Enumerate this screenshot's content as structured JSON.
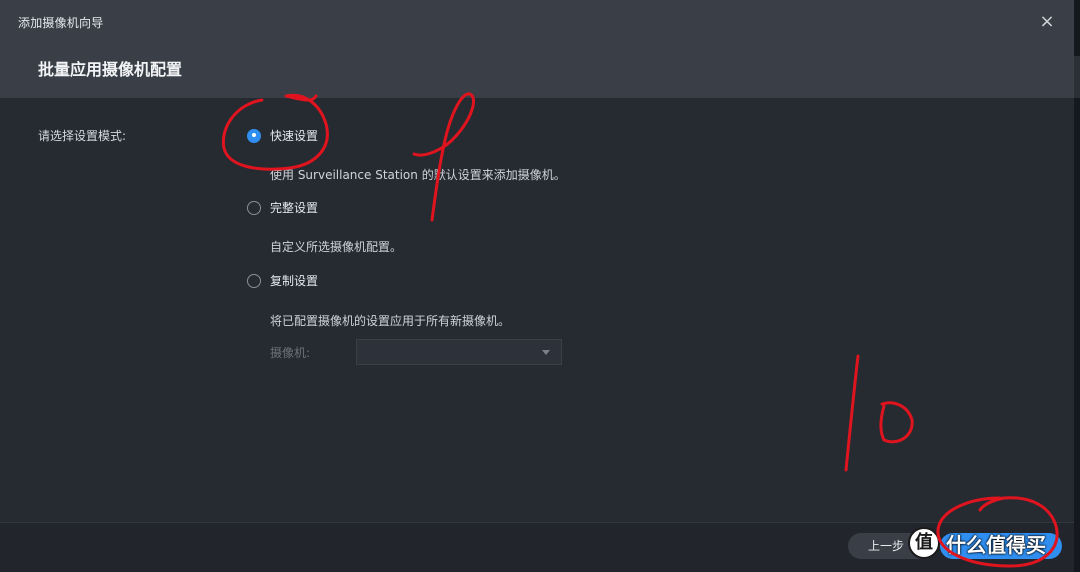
{
  "window": {
    "title": "添加摄像机向导",
    "close_symbol": "×"
  },
  "header": {
    "subtitle": "批量应用摄像机配置"
  },
  "mode": {
    "label": "请选择设置模式:",
    "options": [
      {
        "label": "快速设置",
        "description": "使用 Surveillance Station 的默认设置来添加摄像机。",
        "checked": true
      },
      {
        "label": "完整设置",
        "description": "自定义所选摄像机配置。",
        "checked": false
      },
      {
        "label": "复制设置",
        "description": "将已配置摄像机的设置应用于所有新摄像机。",
        "checked": false
      }
    ]
  },
  "camera_select": {
    "label": "摄像机:",
    "value": ""
  },
  "footer": {
    "prev_label": "上一步",
    "next_label": ""
  },
  "watermark": {
    "logo_char": "值",
    "text": "什么值得买"
  },
  "colors": {
    "accent": "#2f8ef0",
    "annotation": "#e0141e"
  }
}
